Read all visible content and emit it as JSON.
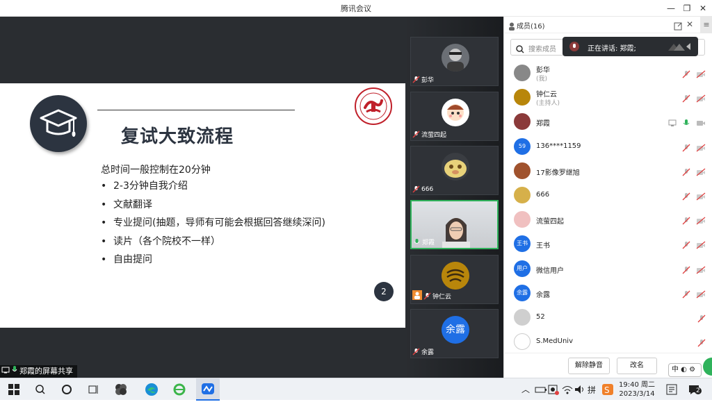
{
  "window": {
    "title": "腾讯会议"
  },
  "slide": {
    "title": "复试大致流程",
    "intro": "总时间一般控制在20分钟",
    "bullets": [
      "2-3分钟自我介绍",
      "文献翻译",
      "专业提问(抽题，导师有可能会根据回答继续深问)",
      "读片（各个院校不一样）",
      "自由提问"
    ],
    "page_number": "2",
    "bullet_mark": "•"
  },
  "share_label": "郑霞的屏幕共享",
  "video_tiles": [
    {
      "name": "彭华",
      "icon": "avatar-photo"
    },
    {
      "name": "流萤四起",
      "icon": "avatar-cartoon-girl"
    },
    {
      "name": "666",
      "icon": "avatar-pet"
    },
    {
      "name": "郑霞",
      "icon": "camera-live"
    },
    {
      "name": "钟仁云",
      "icon": "avatar-logo"
    },
    {
      "name": "余露",
      "initials": "余露",
      "icon": "avatar-initials"
    }
  ],
  "panel": {
    "title": "成员(16)",
    "search_placeholder": "搜索成员",
    "speaking_text": "正在讲话: 郑霞;",
    "members": [
      {
        "name": "彭华",
        "role": "(我)",
        "avatar_text": "",
        "avatar_color": "#888888"
      },
      {
        "name": "钟仁云",
        "role": "(主持人)",
        "avatar_text": "",
        "avatar_color": "#b8860b"
      },
      {
        "name": "郑霞",
        "role": "",
        "avatar_text": "",
        "avatar_color": "#8b3a3a"
      },
      {
        "name": "136****1159",
        "role": "",
        "avatar_text": "59",
        "avatar_color": "#1f6fe5"
      },
      {
        "name": "17影像罗继旭",
        "role": "",
        "avatar_text": "",
        "avatar_color": "#a0522d"
      },
      {
        "name": "666",
        "role": "",
        "avatar_text": "",
        "avatar_color": "#d6b04a"
      },
      {
        "name": "流萤四起",
        "role": "",
        "avatar_text": "",
        "avatar_color": "#f0c0c0"
      },
      {
        "name": "王书",
        "role": "",
        "avatar_text": "王书",
        "avatar_color": "#1f6fe5"
      },
      {
        "name": "微信用户",
        "role": "",
        "avatar_text": "用户",
        "avatar_color": "#1f6fe5"
      },
      {
        "name": "余露",
        "role": "",
        "avatar_text": "余露",
        "avatar_color": "#1f6fe5"
      },
      {
        "name": "52",
        "role": "",
        "avatar_text": "",
        "avatar_color": "#cfcfcf"
      },
      {
        "name": "S.MedUniv",
        "role": "",
        "avatar_text": "",
        "avatar_color": "#ffffff"
      }
    ],
    "unmute_all": "解除静音",
    "rename": "改名"
  },
  "ime": {
    "label": "中"
  },
  "clock": {
    "time": "19:40 周二",
    "date": "2023/3/14"
  },
  "notification_count": "2",
  "colors": {
    "accent": "#1f6fe5",
    "active_border": "#2fb25b",
    "slide_dark": "#2c3440",
    "mute_red": "#e04040"
  }
}
